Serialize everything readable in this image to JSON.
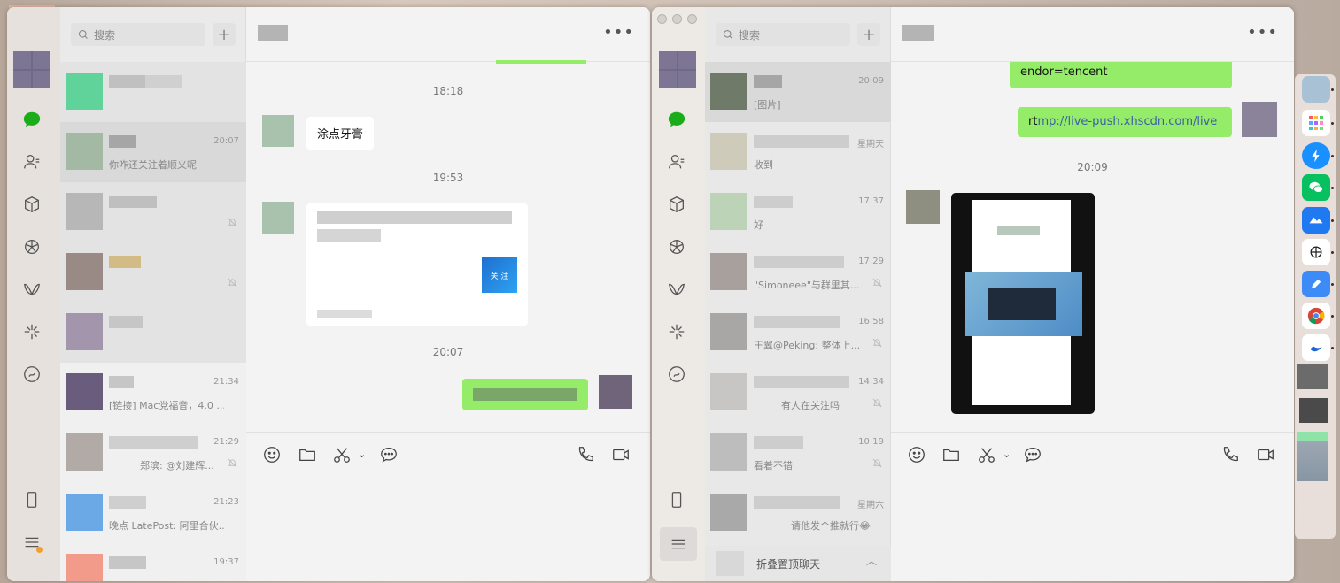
{
  "left_window": {
    "search_placeholder": "搜索",
    "plus_label": "+",
    "more_label": "•••",
    "chats": [
      {
        "time": "",
        "preview": "",
        "avatar_color": "#5fd39a"
      },
      {
        "time": "20:07",
        "preview": "你咋还关注着顺义呢",
        "avatar_color": "#a4b9a3"
      },
      {
        "time": "",
        "preview": "",
        "avatar_color": "#b7b7b7"
      },
      {
        "time": "",
        "preview": "",
        "avatar_color": "#9a8a86"
      },
      {
        "time": "",
        "preview": "",
        "avatar_color": "#a395ab"
      },
      {
        "time": "21:34",
        "preview": "[链接] Mac党福音，4.0 ...",
        "avatar_color": "#6a5c7c"
      },
      {
        "time": "21:29",
        "preview": "郑滨: @刘建辉...",
        "avatar_color": "#b1aaa7"
      },
      {
        "time": "21:23",
        "preview": "晚点 LatePost: 阿里合伙...",
        "avatar_color": "#6ba9e6"
      },
      {
        "time": "19:37",
        "preview": "",
        "avatar_color": "#f29b8a"
      }
    ],
    "messages": {
      "ts1": "18:18",
      "msg1": "涂点牙膏",
      "ts2": "19:53",
      "card_follow": "关 注",
      "ts3": "20:07"
    }
  },
  "right_window": {
    "search_placeholder": "搜索",
    "plus_label": "+",
    "more_label": "•••",
    "chats": [
      {
        "time": "20:09",
        "preview": "[图片]",
        "avatar_color": "#707a68"
      },
      {
        "time": "星期天",
        "preview": "收到",
        "avatar_color": "#cfcbbb"
      },
      {
        "time": "17:37",
        "preview": "好",
        "avatar_color": "#bdd3b7"
      },
      {
        "time": "17:29",
        "preview": "\"Simoneee\"与群里其...",
        "avatar_color": "#a8a09c"
      },
      {
        "time": "16:58",
        "preview": "王翼@Peking: 整体上...",
        "avatar_color": "#a9a7a5"
      },
      {
        "time": "14:34",
        "preview": "有人在关注吗",
        "avatar_color": "#c8c6c4"
      },
      {
        "time": "10:19",
        "preview": "看着不错",
        "avatar_color": "#bdbdbd"
      },
      {
        "time": "星期六",
        "preview": "请他发个推就行😂",
        "avatar_color": "#a9a9a9"
      }
    ],
    "fold_label": "折叠置顶聊天",
    "messages": {
      "msg_top": "endor=tencent",
      "msg_link_prefix": "rt",
      "msg_link": "mp://live-push.xhscdn.com/live",
      "ts1": "20:09"
    }
  },
  "dock": {
    "apps": [
      "finder-icon",
      "launchpad-icon",
      "spark-icon",
      "wechat-icon",
      "lark-icon",
      "chatgpt-icon",
      "pencil-icon",
      "chrome-icon",
      "bird-icon"
    ]
  }
}
